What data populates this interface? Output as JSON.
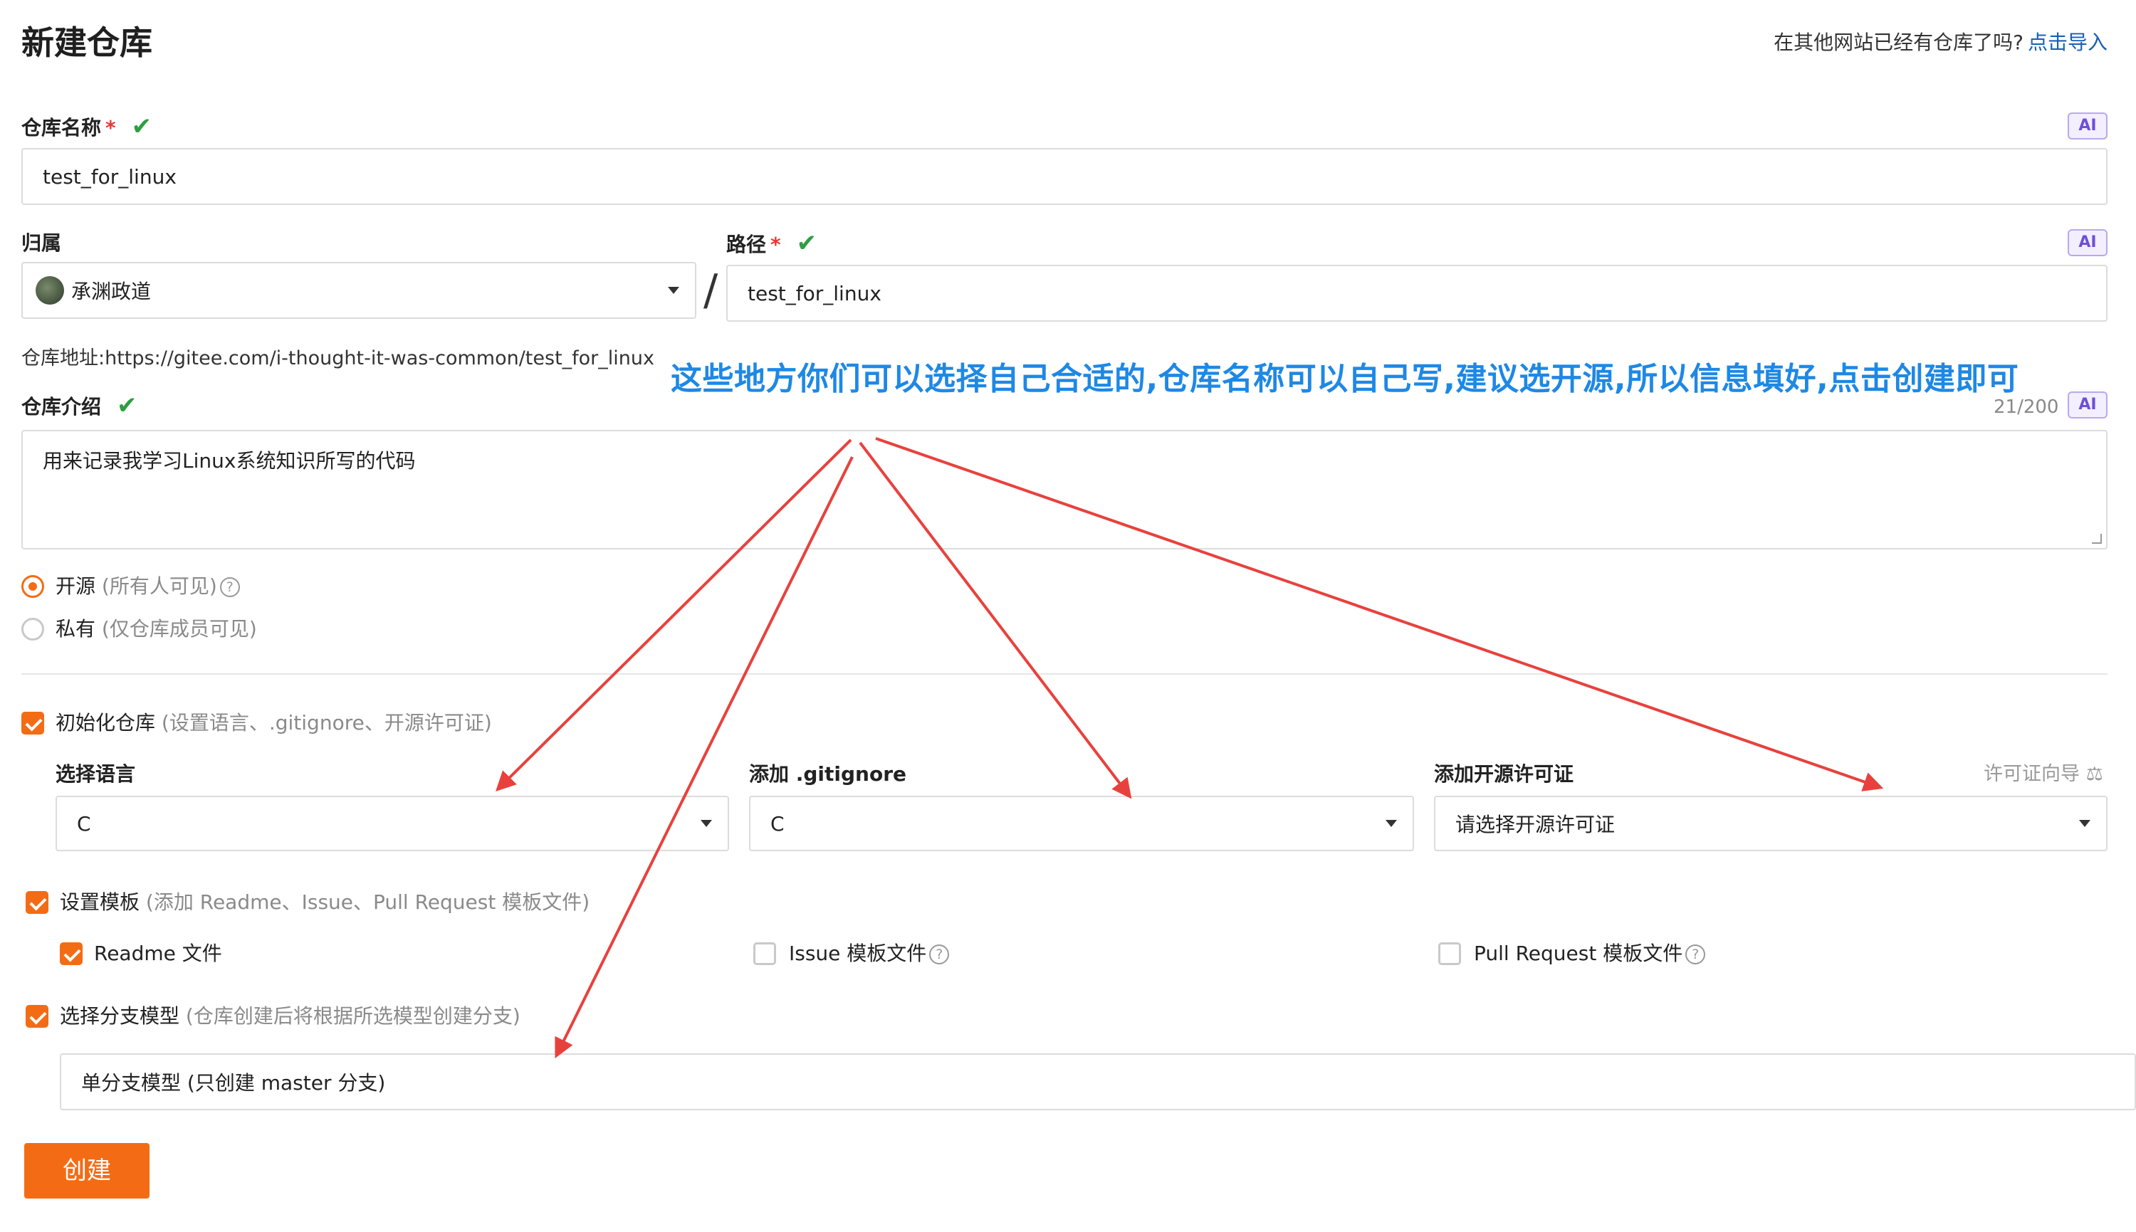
{
  "page": {
    "title": "新建仓库",
    "import_question": "在其他网站已经有仓库了吗?",
    "import_link": "点击导入"
  },
  "repo_name": {
    "label": "仓库名称",
    "required_mark": "*",
    "value": "test_for_linux",
    "ai_badge": "AI",
    "valid_icon": "check-icon"
  },
  "owner": {
    "label": "归属",
    "value": "承渊政道"
  },
  "separator": "/",
  "path": {
    "label": "路径",
    "required_mark": "*",
    "value": "test_for_linux",
    "ai_badge": "AI",
    "valid_icon": "check-icon"
  },
  "repo_address": {
    "label": "仓库地址:",
    "url": "https://gitee.com/i-thought-it-was-common/test_for_linux"
  },
  "annotation": "这些地方你们可以选择自己合适的,仓库名称可以自己写,建议选开源,所以信息填好,点击创建即可",
  "description": {
    "label": "仓库介绍",
    "counter": "21/200",
    "ai_badge": "AI",
    "value": "用来记录我学习Linux系统知识所写的代码"
  },
  "visibility": {
    "public": {
      "label": "开源",
      "hint": "(所有人可见)",
      "selected": true
    },
    "private": {
      "label": "私有",
      "hint": "(仅仓库成员可见)",
      "selected": false
    }
  },
  "init_repo": {
    "label": "初始化仓库",
    "hint": "(设置语言、.gitignore、开源许可证)",
    "checked": true,
    "language": {
      "label": "选择语言",
      "value": "C"
    },
    "gitignore": {
      "label": "添加 .gitignore",
      "value": "C"
    },
    "license": {
      "label": "添加开源许可证",
      "guide": "许可证向导",
      "value": "请选择开源许可证"
    }
  },
  "template": {
    "label": "设置模板",
    "hint": "(添加 Readme、Issue、Pull Request 模板文件)",
    "checked": true,
    "readme": {
      "label": "Readme 文件",
      "checked": true
    },
    "issue": {
      "label": "Issue 模板文件",
      "checked": false
    },
    "pr": {
      "label": "Pull Request 模板文件",
      "checked": false
    }
  },
  "branch_model": {
    "label": "选择分支模型",
    "hint": "(仓库创建后将根据所选模型创建分支)",
    "checked": true,
    "value": "单分支模型 (只创建 master 分支)"
  },
  "create_button": "创建",
  "colors": {
    "accent": "#f36c15",
    "link": "#1a5fb4",
    "annotation": "#1e88e5",
    "arrow": "#e8413d",
    "valid": "#2e9e43"
  }
}
